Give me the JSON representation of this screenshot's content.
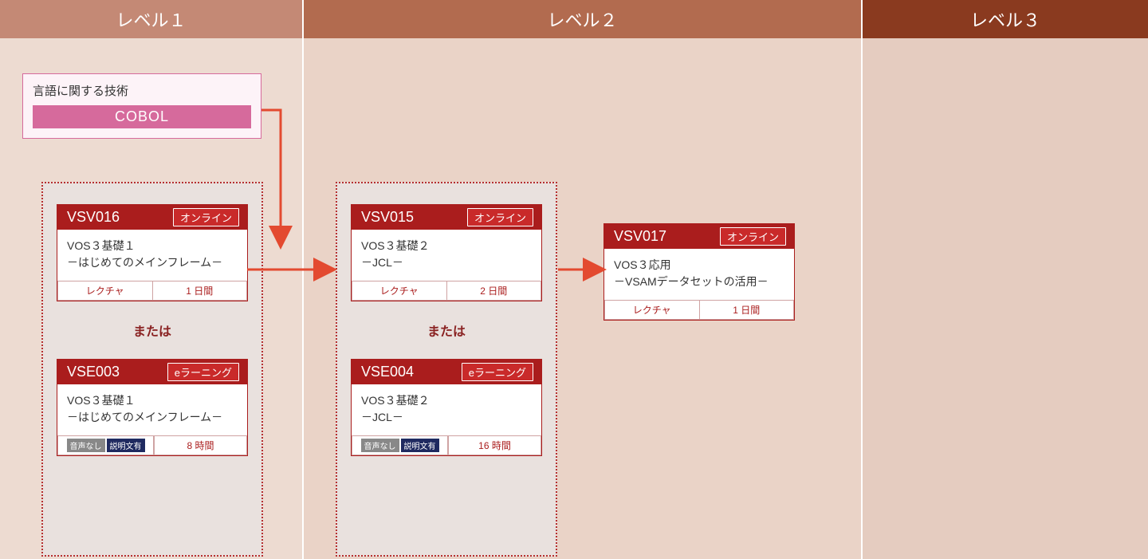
{
  "levels": {
    "l1": "レベル１",
    "l2": "レベル２",
    "l3": "レベル３"
  },
  "skill": {
    "title": "言語に関する技術",
    "tag": "COBOL"
  },
  "or_label": "または",
  "groups": {
    "g1": {
      "card_a": {
        "code": "VSV016",
        "mode": "オンライン",
        "title_line1": "VOS３基礎１",
        "title_line2": "－はじめてのメインフレーム－",
        "format": "レクチャ",
        "duration_value": "1",
        "duration_unit": "日間"
      },
      "card_b": {
        "code": "VSE003",
        "mode": "eラーニング",
        "title_line1": "VOS３基礎１",
        "title_line2": "－はじめてのメインフレーム－",
        "badge_audio": "音声なし",
        "badge_text": "説明文有",
        "duration_value": "8",
        "duration_unit": "時間"
      }
    },
    "g2": {
      "card_a": {
        "code": "VSV015",
        "mode": "オンライン",
        "title_line1": "VOS３基礎２",
        "title_line2": "－JCL－",
        "format": "レクチャ",
        "duration_value": "2",
        "duration_unit": "日間"
      },
      "card_b": {
        "code": "VSE004",
        "mode": "eラーニング",
        "title_line1": "VOS３基礎２",
        "title_line2": "－JCL－",
        "badge_audio": "音声なし",
        "badge_text": "説明文有",
        "duration_value": "16",
        "duration_unit": "時間"
      }
    },
    "standalone": {
      "code": "VSV017",
      "mode": "オンライン",
      "title_line1": "VOS３応用",
      "title_line2": "－VSAMデータセットの活用－",
      "format": "レクチャ",
      "duration_value": "1",
      "duration_unit": "日間"
    }
  },
  "arrows": {
    "color": "#e34a30"
  }
}
